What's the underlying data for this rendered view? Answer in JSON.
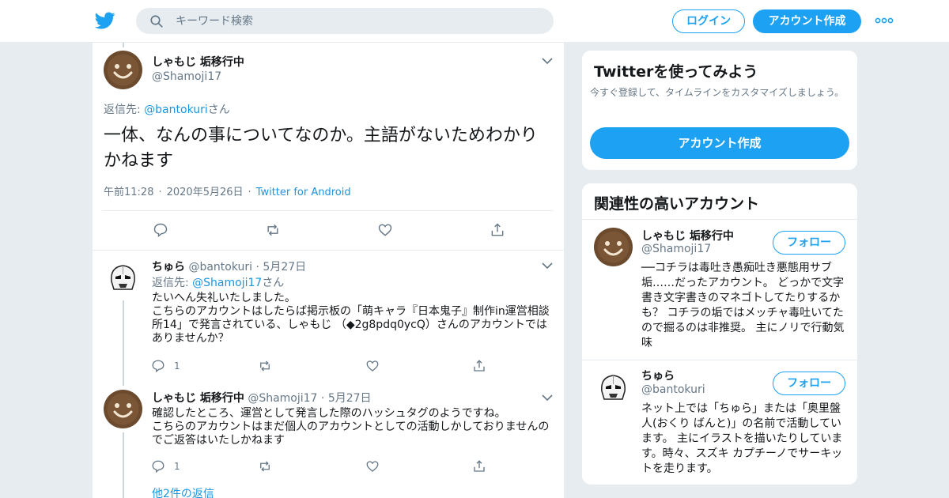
{
  "header": {
    "search_placeholder": "キーワード検索",
    "login_label": "ログイン",
    "signup_label": "アカウント作成"
  },
  "main_tweet": {
    "name": "しゃもじ 垢移行中",
    "handle": "@Shamoji17",
    "replying_prefix": "返信先: ",
    "replying_to": "@bantokuri",
    "replying_suffix": "さん",
    "text": "一体、なんの事についてなのか。主語がないためわかりかねます",
    "time": "午前11:28",
    "date": "2020年5月26日",
    "source": "Twitter for Android"
  },
  "replies": [
    {
      "name": "ちゅら",
      "handle": "@bantokuri",
      "date": "5月27日",
      "replying_prefix": "返信先: ",
      "replying_to": "@Shamoji17",
      "replying_suffix": "さん",
      "text": "たいへん失礼いたしました。\nこちらのアカウントはしたらば掲示板の「萌キャラ『日本鬼子』制作in運営相談所14」で発言されている、しゃもじ （◆2g8pdq0ycQ）さんのアカウントではありませんか？",
      "reply_count": "1"
    },
    {
      "name": "しゃもじ 垢移行中",
      "handle": "@Shamoji17",
      "date": "5月27日",
      "text": "確認したところ、運営として発言した際のハッシュタグのようですね。\nこちらのアカウントはまだ個人のアカウントとしての活動しかしておりませんのでご返答はいたしかねます",
      "reply_count": "1"
    }
  ],
  "more_replies": "他2件の返信",
  "sidebar": {
    "signup_card": {
      "title": "Twitterを使ってみよう",
      "subtitle": "今すぐ登録して、タイムラインをカスタマイズしましょう。",
      "button": "アカウント作成"
    },
    "related": {
      "title": "関連性の高いアカウント",
      "follow_label": "フォロー",
      "accounts": [
        {
          "name": "しゃもじ 垢移行中",
          "handle": "@Shamoji17",
          "bio": "──コチラは毒吐き愚痴吐き悪態用サブ垢……だったアカウント。 どっかで文字書き文字書きのマネゴトしてたりするかも？ コチラの垢ではメッチャ毒吐いてたので掘るのは非推奨。 主にノリで行動気味"
        },
        {
          "name": "ちゅら",
          "handle": "@bantokuri",
          "bio": "ネット上では「ちゅら」または「奥里盤人(おくり ばんと)」の名前で活動しています。 主にイラストを描いたりしています。時々、スズキ カプチーノでサーキットを走ります。"
        }
      ]
    }
  },
  "colors": {
    "accent": "#1da1f2",
    "link": "#1b95e0",
    "muted": "#657786",
    "background": "#e6ecf0"
  }
}
